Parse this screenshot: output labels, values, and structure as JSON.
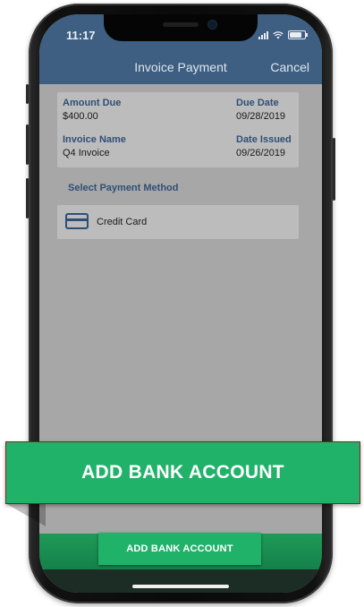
{
  "status_bar": {
    "time": "11:17"
  },
  "nav": {
    "title": "Invoice Payment",
    "cancel_label": "Cancel"
  },
  "invoice": {
    "amount_due_label": "Amount Due",
    "amount_due_value": "$400.00",
    "due_date_label": "Due Date",
    "due_date_value": "09/28/2019",
    "invoice_name_label": "Invoice Name",
    "invoice_name_value": "Q4 Invoice",
    "date_issued_label": "Date Issued",
    "date_issued_value": "09/26/2019"
  },
  "payment": {
    "section_title": "Select Payment Method",
    "methods": [
      {
        "label": "Credit Card",
        "icon": "credit-card-icon"
      }
    ]
  },
  "callout": {
    "label": "ADD BANK ACCOUNT"
  },
  "bottom_button": {
    "label": "ADD BANK ACCOUNT"
  },
  "colors": {
    "header": "#3e5f82",
    "accent_green": "#21b26a",
    "label_blue": "#2f4f76",
    "overlay_gray": "#a7a7a7"
  }
}
